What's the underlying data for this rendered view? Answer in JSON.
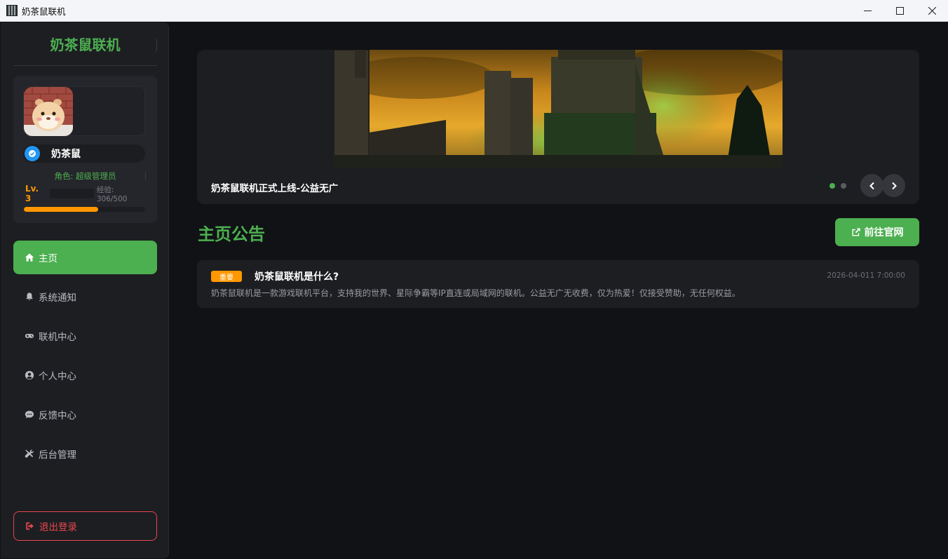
{
  "window": {
    "title": "奶茶鼠联机",
    "minimize_icon": "minimize-icon",
    "maximize_icon": "maximize-icon",
    "close_icon": "close-icon"
  },
  "sidebar": {
    "brand": "奶茶鼠联机",
    "user": {
      "name": "奶茶鼠",
      "role": "角色: 超级管理员",
      "level": "Lv. 3",
      "exp_text": "经验: 306/500",
      "exp_current": 306,
      "exp_max": 500
    },
    "nav": [
      {
        "label": "主页",
        "icon": "home-icon",
        "active": true
      },
      {
        "label": "系统通知",
        "icon": "bell-icon",
        "active": false
      },
      {
        "label": "联机中心",
        "icon": "gamepad-icon",
        "active": false
      },
      {
        "label": "个人中心",
        "icon": "user-circle-icon",
        "active": false
      },
      {
        "label": "反馈中心",
        "icon": "chat-icon",
        "active": false
      },
      {
        "label": "后台管理",
        "icon": "tools-icon",
        "active": false
      }
    ],
    "logout_label": "退出登录"
  },
  "main": {
    "banner": {
      "caption": "奶茶鼠联机正式上线-公益无广",
      "slide_count": 2,
      "active_slide": 0
    },
    "section_title": "主页公告",
    "site_button_label": "前往官网",
    "notices": [
      {
        "badge": "重要",
        "title": "奶茶鼠联机是什么?",
        "date": "2026-04-011 7:00:00",
        "body": "奶茶鼠联机是一款游戏联机平台，支持我的世界、星际争霸等IP直连或局域网的联机。公益无广无收费，仅为热爱！仅接受赞助，无任何权益。"
      }
    ]
  },
  "colors": {
    "accent": "#4caf50",
    "warning": "#ff9800",
    "danger": "#e5484d",
    "background": "#111216",
    "card": "#1d1e22"
  }
}
